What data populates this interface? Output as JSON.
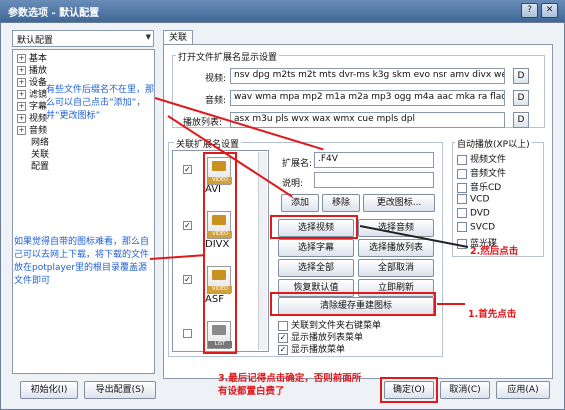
{
  "window": {
    "title": "参数选项 - 默认配置",
    "help_label": "?",
    "close_label": "✕"
  },
  "left": {
    "profile_combo": "默认配置",
    "tree": [
      {
        "label": "基本",
        "expand": "+"
      },
      {
        "label": "播放",
        "expand": "+"
      },
      {
        "label": "设备",
        "expand": "+"
      },
      {
        "label": "滤镜",
        "expand": "+"
      },
      {
        "label": "字幕",
        "expand": "+"
      },
      {
        "label": "视频",
        "expand": "+"
      },
      {
        "label": "音频",
        "expand": "+"
      },
      {
        "label": "网络",
        "expand": ""
      },
      {
        "label": "关联",
        "expand": ""
      },
      {
        "label": "配置",
        "expand": ""
      }
    ],
    "init_button": "初始化(I)",
    "export_button": "导出配置(S)"
  },
  "tab": {
    "label": "关联"
  },
  "ext_group": {
    "title": "打开文件扩展名显示设置",
    "rows": [
      {
        "label": "视频:",
        "value": "nsv dpg m2ts m2t mts dvr-ms k3g skm evo nsr amv divx webm",
        "btn": "D"
      },
      {
        "label": "音频:",
        "value": "wav wma mpa mp2 m1a m2a mp3 ogg m4a aac mka ra flac ape",
        "btn": "D"
      },
      {
        "label": "播放列表:",
        "value": "asx m3u pls wvx wax wmx cue mpls dpl",
        "btn": "D"
      }
    ]
  },
  "assoc_group": {
    "title": "关联扩展名设置",
    "items": [
      {
        "name": "AVI",
        "checked": true,
        "icon_tag": "VIDEO"
      },
      {
        "name": "DIVX",
        "checked": true,
        "icon_tag": "VIDEO"
      },
      {
        "name": "ASF",
        "checked": true,
        "icon_tag": "VIDEO"
      },
      {
        "name": "",
        "checked": false,
        "icon_tag": "LIST"
      }
    ],
    "ext_label": "扩展名:",
    "ext_value": ".F4V",
    "desc_label": "说明:",
    "desc_value": "",
    "add_btn": "添加",
    "remove_btn": "移除",
    "change_icon_btn": "更改图标..."
  },
  "select_buttons": [
    "选择视频",
    "选择音频",
    "选择字幕",
    "选择播放列表",
    "选择全部",
    "全部取消",
    "恢复默认值",
    "立即刷新"
  ],
  "clear_cache_btn": "清除缓存重建图标",
  "menu_checks": [
    {
      "label": "关联到文件夹右键菜单",
      "checked": false
    },
    {
      "label": "显示播放列表菜单",
      "checked": true
    },
    {
      "label": "显示播放菜单",
      "checked": true
    }
  ],
  "autoplay": {
    "title": "自动播放(XP以上)",
    "items": [
      "视频文件",
      "音频文件",
      "音乐CD",
      "VCD",
      "DVD",
      "SVCD",
      "蓝光碟"
    ]
  },
  "bottom_buttons": {
    "ok": "确定(O)",
    "cancel": "取消(C)",
    "apply": "应用(A)"
  },
  "annotations": {
    "top_note": "有些文件后缀名不在里，那么可以自己点击“添加”，并“更改图标”",
    "left_note": "如果觉得自带的图标难看，那么自己可以去网上下载，将下载的文件放在potplayer里的根目录覆盖源文件即可",
    "step1": "1.首先点击",
    "step2": "2.然后点击",
    "step3": "3.最后记得点击确定，否则前面所有设都置白费了"
  },
  "colors": {
    "annotation_red": "#e0191b",
    "annotation_blue": "#1f5fd6",
    "title_bar": "#4a72a3"
  }
}
